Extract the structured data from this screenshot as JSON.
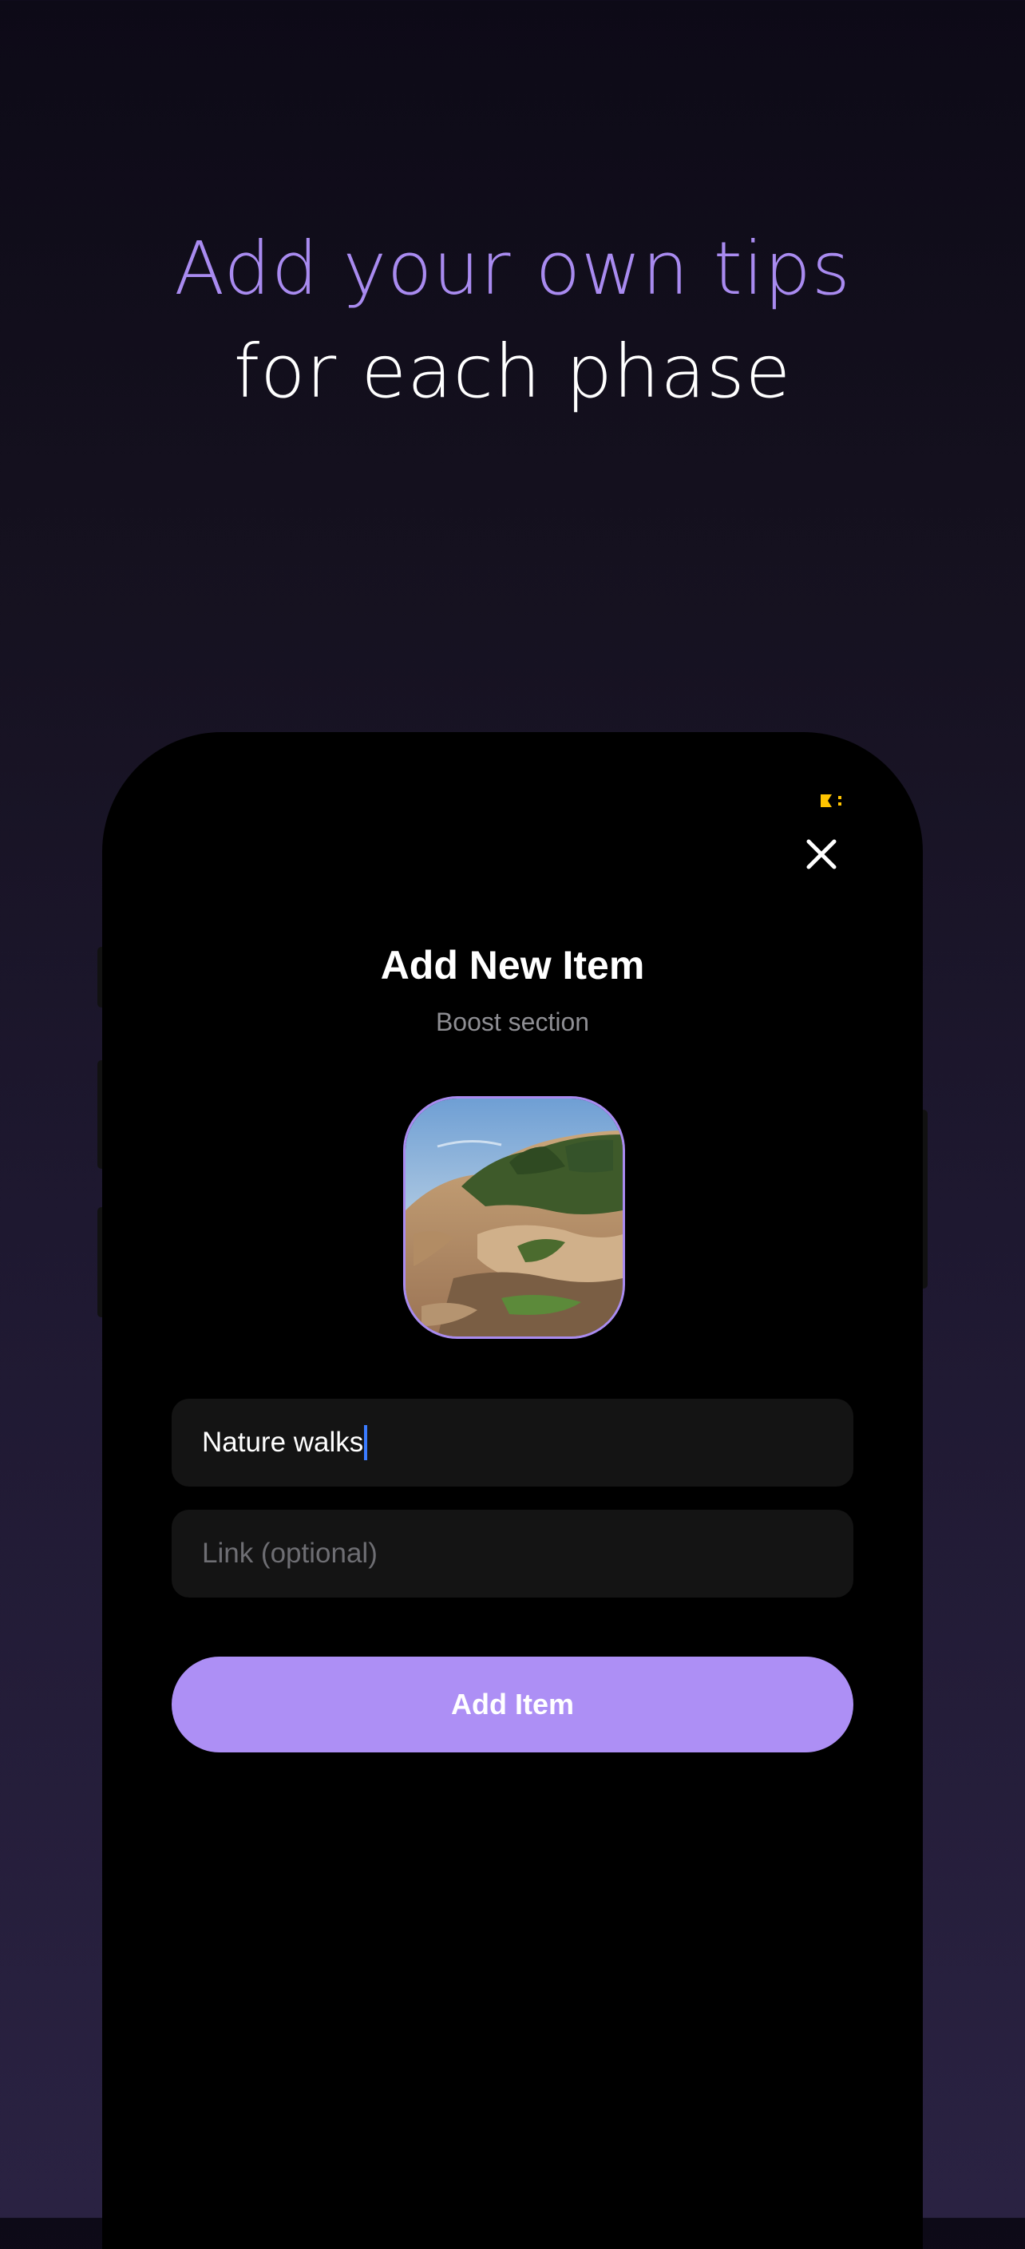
{
  "headline": {
    "line1": "Add your own tips",
    "line2": "for each phase"
  },
  "colors": {
    "accent": "#ad8ff5",
    "headline_accent": "#a98bf0",
    "field_bg": "#141414",
    "status_indicator": "#ffc400"
  },
  "modal": {
    "title": "Add New Item",
    "subtitle": "Boost section",
    "close_icon": "close-icon",
    "name_value": "Nature walks",
    "link_placeholder": "Link (optional)",
    "submit_label": "Add Item"
  }
}
